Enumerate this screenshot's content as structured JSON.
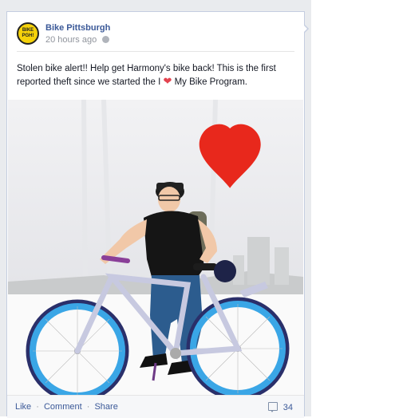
{
  "post": {
    "author": "Bike Pittsburgh",
    "timestamp": "20 hours ago",
    "privacy_icon": "globe-icon",
    "avatar_text_line1": "BIKE",
    "avatar_text_line2": "PGH!",
    "message_before_heart": "Stolen bike alert!! Help get Harmony's bike back! This is the first reported theft since we started the I",
    "heart_glyph": "❤",
    "message_after_heart": " My Bike Program."
  },
  "photo": {
    "description_icon": "photo",
    "backdrop_heart_color": "#e8281c",
    "bike_frame_color": "#c7c9e0",
    "rim_color": "#3aa6e6"
  },
  "footer": {
    "like_label": "Like",
    "comment_label": "Comment",
    "share_label": "Share",
    "separator": "·",
    "comment_count": "34"
  },
  "colors": {
    "link_blue": "#3b5998",
    "meta_gray": "#90949c",
    "timeline_bg": "#e9ebee"
  }
}
